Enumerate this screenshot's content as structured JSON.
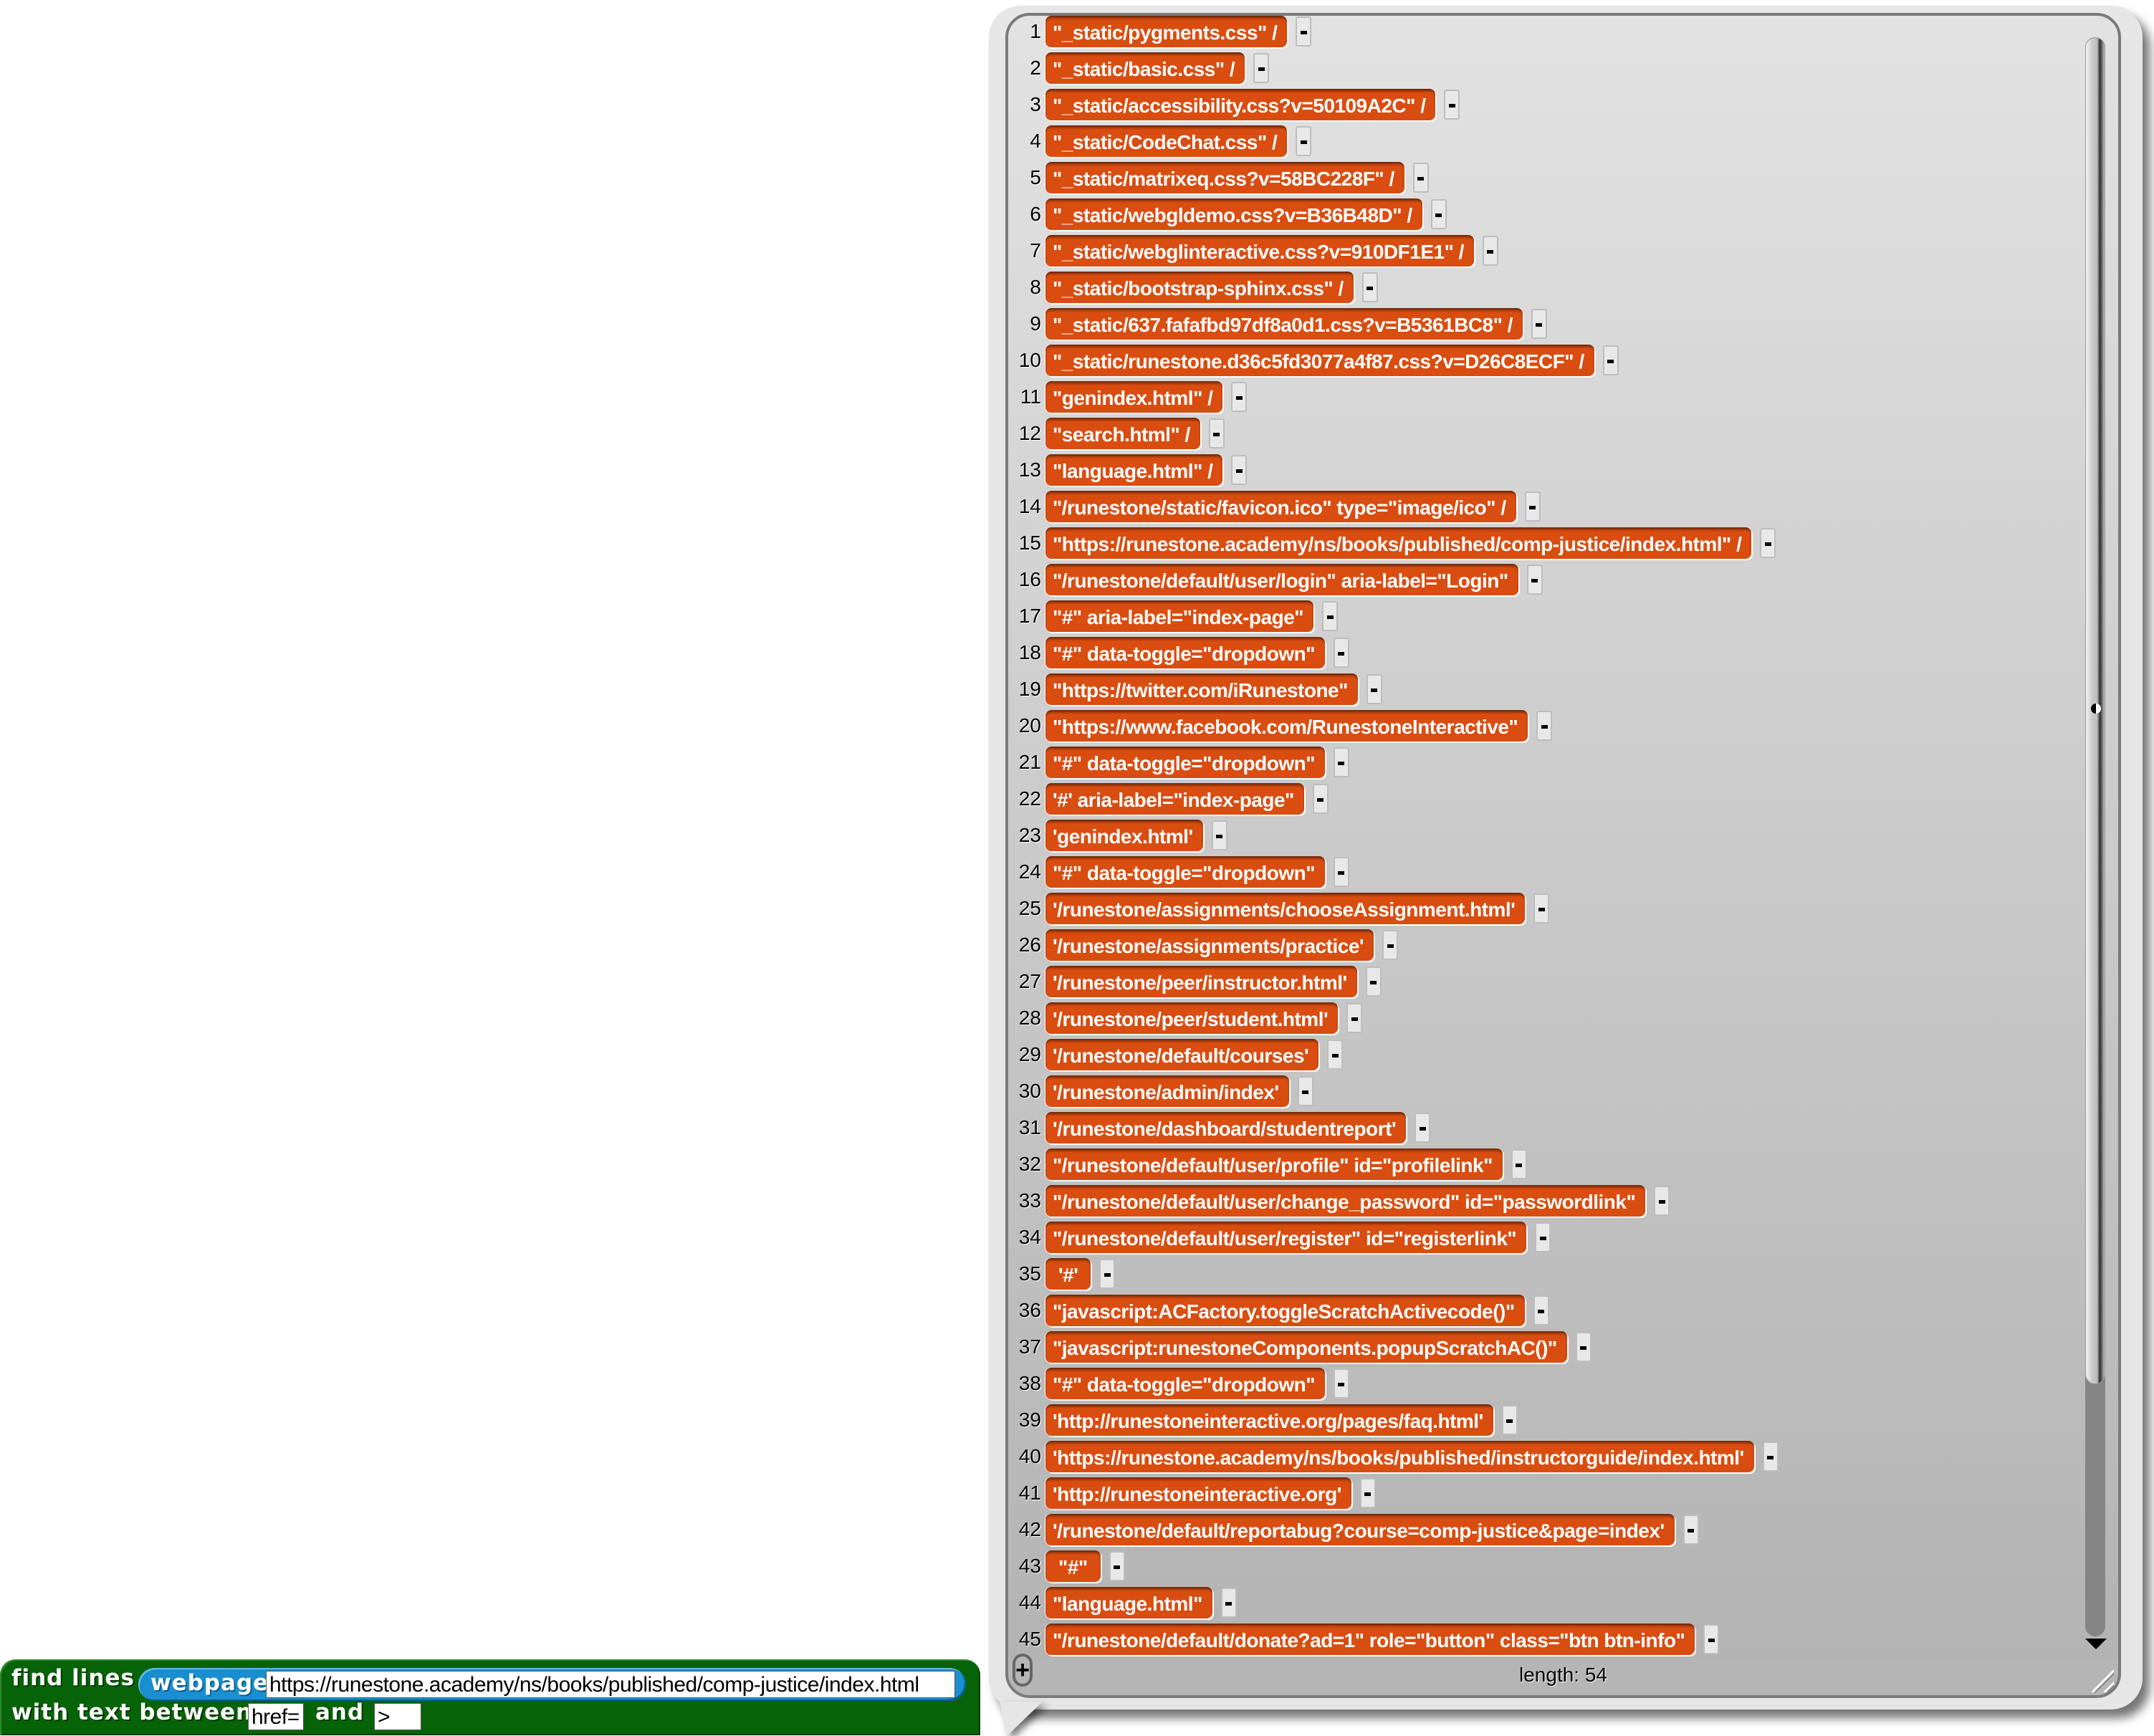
{
  "block": {
    "label_find_lines": "find lines",
    "reporter_label": "webpage",
    "url_value": "https://runestone.academy/ns/books/published/comp-justice/index.html",
    "label_with_text_between": "with text between",
    "start_value": "href=",
    "label_and": "and",
    "end_value": ">"
  },
  "result_list": {
    "length_label": "length: 54",
    "items": [
      {
        "index": "1",
        "text": "\"_static/pygments.css\" /"
      },
      {
        "index": "2",
        "text": "\"_static/basic.css\" /"
      },
      {
        "index": "3",
        "text": "\"_static/accessibility.css?v=50109A2C\" /"
      },
      {
        "index": "4",
        "text": "\"_static/CodeChat.css\" /"
      },
      {
        "index": "5",
        "text": "\"_static/matrixeq.css?v=58BC228F\" /"
      },
      {
        "index": "6",
        "text": "\"_static/webgldemo.css?v=B36B48D\" /"
      },
      {
        "index": "7",
        "text": "\"_static/webglinteractive.css?v=910DF1E1\" /"
      },
      {
        "index": "8",
        "text": "\"_static/bootstrap-sphinx.css\" /"
      },
      {
        "index": "9",
        "text": "\"_static/637.fafafbd97df8a0d1.css?v=B5361BC8\" /"
      },
      {
        "index": "10",
        "text": "\"_static/runestone.d36c5fd3077a4f87.css?v=D26C8ECF\" /"
      },
      {
        "index": "11",
        "text": "\"genindex.html\" /"
      },
      {
        "index": "12",
        "text": "\"search.html\" /"
      },
      {
        "index": "13",
        "text": "\"language.html\" /"
      },
      {
        "index": "14",
        "text": "\"/runestone/static/favicon.ico\" type=\"image/ico\" /"
      },
      {
        "index": "15",
        "text": "\"https://runestone.academy/ns/books/published/comp-justice/index.html\" /"
      },
      {
        "index": "16",
        "text": "\"/runestone/default/user/login\" aria-label=\"Login\""
      },
      {
        "index": "17",
        "text": "\"#\" aria-label=\"index-page\""
      },
      {
        "index": "18",
        "text": "\"#\" data-toggle=\"dropdown\""
      },
      {
        "index": "19",
        "text": "\"https://twitter.com/iRunestone\""
      },
      {
        "index": "20",
        "text": "\"https://www.facebook.com/RunestoneInteractive\""
      },
      {
        "index": "21",
        "text": "\"#\" data-toggle=\"dropdown\""
      },
      {
        "index": "22",
        "text": "'#' aria-label=\"index-page\""
      },
      {
        "index": "23",
        "text": "'genindex.html'"
      },
      {
        "index": "24",
        "text": "\"#\" data-toggle=\"dropdown\""
      },
      {
        "index": "25",
        "text": "'/runestone/assignments/chooseAssignment.html'"
      },
      {
        "index": "26",
        "text": "'/runestone/assignments/practice'"
      },
      {
        "index": "27",
        "text": "'/runestone/peer/instructor.html'"
      },
      {
        "index": "28",
        "text": "'/runestone/peer/student.html'"
      },
      {
        "index": "29",
        "text": "'/runestone/default/courses'"
      },
      {
        "index": "30",
        "text": "'/runestone/admin/index'"
      },
      {
        "index": "31",
        "text": "'/runestone/dashboard/studentreport'"
      },
      {
        "index": "32",
        "text": "\"/runestone/default/user/profile\" id=\"profilelink\""
      },
      {
        "index": "33",
        "text": "\"/runestone/default/user/change_password\" id=\"passwordlink\""
      },
      {
        "index": "34",
        "text": "\"/runestone/default/user/register\" id=\"registerlink\""
      },
      {
        "index": "35",
        "text": "'#'"
      },
      {
        "index": "36",
        "text": "\"javascript:ACFactory.toggleScratchActivecode()\""
      },
      {
        "index": "37",
        "text": "\"javascript:runestoneComponents.popupScratchAC()\""
      },
      {
        "index": "38",
        "text": "\"#\" data-toggle=\"dropdown\""
      },
      {
        "index": "39",
        "text": "'http://runestoneinteractive.org/pages/faq.html'"
      },
      {
        "index": "40",
        "text": "'https://runestone.academy/ns/books/published/instructorguide/index.html'"
      },
      {
        "index": "41",
        "text": "'http://runestoneinteractive.org'"
      },
      {
        "index": "42",
        "text": "'/runestone/default/reportabug?course=comp-justice&page=index'"
      },
      {
        "index": "43",
        "text": "\"#\""
      },
      {
        "index": "44",
        "text": "\"language.html\""
      },
      {
        "index": "45",
        "text": "\"/runestone/default/donate?ad=1\" role=\"button\" class=\"btn btn-info\""
      }
    ]
  },
  "icons": {
    "add_item": "+",
    "remove_item": "-",
    "scroll_down": "triangle-down",
    "resize": "resize-grip"
  },
  "colors": {
    "list_item": "#d94d11",
    "block_green": "#076307",
    "reporter_blue": "#1a8fd0"
  }
}
